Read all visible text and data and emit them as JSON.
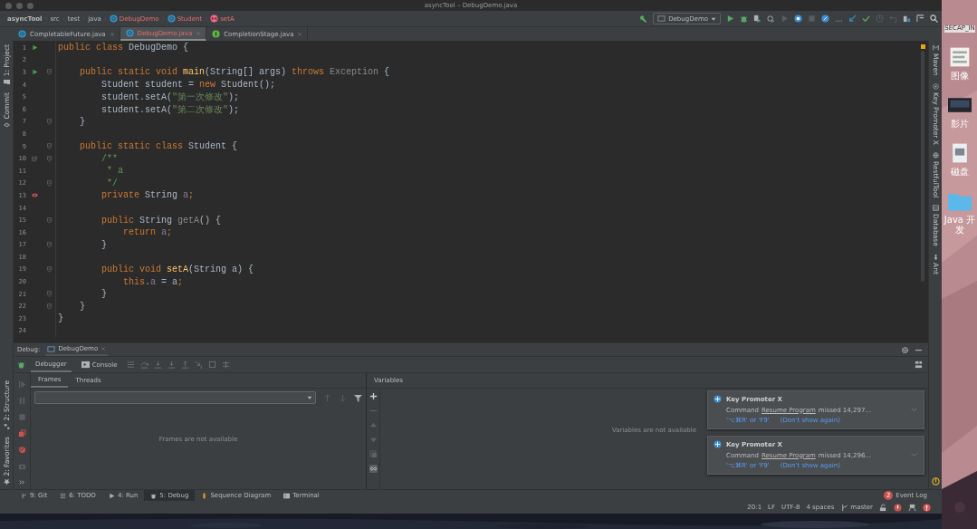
{
  "window": {
    "title": "asyncTool – DebugDemo.java"
  },
  "breadcrumbs": [
    {
      "label": "asyncTool",
      "kind": "project",
      "has_errors": false
    },
    {
      "label": "src",
      "kind": "folder",
      "has_errors": false
    },
    {
      "label": "test",
      "kind": "folder",
      "has_errors": false
    },
    {
      "label": "java",
      "kind": "folder",
      "has_errors": false
    },
    {
      "label": "DebugDemo",
      "kind": "class",
      "has_errors": true
    },
    {
      "label": "Student",
      "kind": "class",
      "has_errors": true
    },
    {
      "label": "setA",
      "kind": "method",
      "has_errors": true
    }
  ],
  "run_config": "DebugDemo",
  "editor_tabs": [
    {
      "label": "CompletableFuture.java",
      "kind": "class",
      "selected": false,
      "has_errors": false
    },
    {
      "label": "DebugDemo.java",
      "kind": "class",
      "selected": true,
      "has_errors": true
    },
    {
      "label": "CompletionStage.java",
      "kind": "interface",
      "selected": false,
      "has_errors": false
    }
  ],
  "left_tool_windows": [
    {
      "label": "1: Project",
      "kind": "folder"
    },
    {
      "label": "Commit",
      "kind": "commit"
    }
  ],
  "left_tool_windows_bottom": [
    {
      "label": "2: Structure",
      "kind": "structure"
    },
    {
      "label": "2: Favorites",
      "kind": "star"
    }
  ],
  "right_tool_windows": [
    {
      "label": "Maven",
      "kind": "m"
    },
    {
      "label": "Key Promoter X",
      "kind": "key"
    },
    {
      "label": "RestfulTool",
      "kind": "globe"
    },
    {
      "label": "Database",
      "kind": "db"
    },
    {
      "label": "Ant",
      "kind": "ant"
    }
  ],
  "code_lines": [
    {
      "number": "1",
      "runnable": true,
      "breakpoint": false,
      "doc_toggle": false,
      "fold": false,
      "tokens": [
        {
          "kind": "kw",
          "text": "public class "
        },
        {
          "kind": "plain",
          "text": "DebugDemo {"
        }
      ]
    },
    {
      "number": "2",
      "runnable": false,
      "breakpoint": false,
      "doc_toggle": false,
      "fold": false
    },
    {
      "number": "3",
      "runnable": true,
      "breakpoint": false,
      "doc_toggle": false,
      "fold": true,
      "tokens": [
        {
          "kind": "kw",
          "text": "    public static void "
        },
        {
          "kind": "decl",
          "text": "main"
        },
        {
          "kind": "plain",
          "text": "(String[] args) "
        },
        {
          "kind": "kw",
          "text": "throws "
        },
        {
          "kind": "gray",
          "text": "Exception "
        },
        {
          "kind": "plain",
          "text": "{"
        }
      ]
    },
    {
      "number": "4",
      "runnable": false,
      "breakpoint": false,
      "doc_toggle": false,
      "fold": false,
      "tokens": [
        {
          "kind": "plain",
          "text": "        Student student = "
        },
        {
          "kind": "kw",
          "text": "new "
        },
        {
          "kind": "plain",
          "text": "Student();"
        }
      ]
    },
    {
      "number": "5",
      "runnable": false,
      "breakpoint": false,
      "doc_toggle": false,
      "fold": false,
      "tokens": [
        {
          "kind": "plain",
          "text": "        student.setA("
        },
        {
          "kind": "str",
          "text": "\"第一次修改\""
        },
        {
          "kind": "plain",
          "text": ");"
        }
      ]
    },
    {
      "number": "6",
      "runnable": false,
      "breakpoint": false,
      "doc_toggle": false,
      "fold": false,
      "tokens": [
        {
          "kind": "plain",
          "text": "        student.setA("
        },
        {
          "kind": "str",
          "text": "\"第二次修改\""
        },
        {
          "kind": "plain",
          "text": ");"
        }
      ]
    },
    {
      "number": "7",
      "runnable": false,
      "breakpoint": false,
      "doc_toggle": false,
      "fold": true,
      "tokens": [
        {
          "kind": "plain",
          "text": "    }"
        }
      ]
    },
    {
      "number": "8",
      "runnable": false,
      "breakpoint": false,
      "doc_toggle": false,
      "fold": false
    },
    {
      "number": "9",
      "runnable": false,
      "breakpoint": false,
      "doc_toggle": false,
      "fold": true,
      "tokens": [
        {
          "kind": "kw",
          "text": "    public static class "
        },
        {
          "kind": "plain",
          "text": "Student {"
        }
      ]
    },
    {
      "number": "10",
      "runnable": false,
      "breakpoint": false,
      "doc_toggle": true,
      "fold": true,
      "tokens": [
        {
          "kind": "doc",
          "text": "        /**"
        }
      ]
    },
    {
      "number": "11",
      "runnable": false,
      "breakpoint": false,
      "doc_toggle": false,
      "fold": false,
      "tokens": [
        {
          "kind": "doc",
          "text": "         * a"
        }
      ]
    },
    {
      "number": "12",
      "runnable": false,
      "breakpoint": false,
      "doc_toggle": false,
      "fold": true,
      "tokens": [
        {
          "kind": "doc",
          "text": "         */"
        }
      ]
    },
    {
      "number": "13",
      "runnable": false,
      "breakpoint": true,
      "doc_toggle": false,
      "fold": false,
      "tokens": [
        {
          "kind": "kw",
          "text": "        private "
        },
        {
          "kind": "plain",
          "text": "String "
        },
        {
          "kind": "field",
          "text": "a"
        },
        {
          "kind": "kw",
          "text": ";"
        }
      ]
    },
    {
      "number": "14",
      "runnable": false,
      "breakpoint": false,
      "doc_toggle": false,
      "fold": false
    },
    {
      "number": "15",
      "runnable": false,
      "breakpoint": false,
      "doc_toggle": false,
      "fold": true,
      "tokens": [
        {
          "kind": "kw",
          "text": "        public "
        },
        {
          "kind": "plain",
          "text": "String "
        },
        {
          "kind": "gray",
          "text": "getA"
        },
        {
          "kind": "plain",
          "text": "() {"
        }
      ]
    },
    {
      "number": "16",
      "runnable": false,
      "breakpoint": false,
      "doc_toggle": false,
      "fold": false,
      "tokens": [
        {
          "kind": "kw",
          "text": "            return "
        },
        {
          "kind": "field",
          "text": "a"
        },
        {
          "kind": "kw",
          "text": ";"
        }
      ]
    },
    {
      "number": "17",
      "runnable": false,
      "breakpoint": false,
      "doc_toggle": false,
      "fold": true,
      "tokens": [
        {
          "kind": "plain",
          "text": "        }"
        }
      ]
    },
    {
      "number": "18",
      "runnable": false,
      "breakpoint": false,
      "doc_toggle": false,
      "fold": false
    },
    {
      "number": "19",
      "runnable": false,
      "breakpoint": false,
      "doc_toggle": false,
      "fold": true,
      "tokens": [
        {
          "kind": "kw",
          "text": "        public void "
        },
        {
          "kind": "decl",
          "text": "setA"
        },
        {
          "kind": "plain",
          "text": "(String a) {"
        }
      ]
    },
    {
      "number": "20",
      "runnable": false,
      "breakpoint": false,
      "doc_toggle": false,
      "fold": false,
      "tokens": [
        {
          "kind": "kw",
          "text": "            this"
        },
        {
          "kind": "plain",
          "text": "."
        },
        {
          "kind": "field",
          "text": "a"
        },
        {
          "kind": "plain",
          "text": " = a"
        },
        {
          "kind": "kw",
          "text": ";"
        }
      ]
    },
    {
      "number": "21",
      "runnable": false,
      "breakpoint": false,
      "doc_toggle": false,
      "fold": true,
      "tokens": [
        {
          "kind": "plain",
          "text": "        }"
        }
      ]
    },
    {
      "number": "22",
      "runnable": false,
      "breakpoint": false,
      "doc_toggle": false,
      "fold": true,
      "tokens": [
        {
          "kind": "plain",
          "text": "    }"
        }
      ]
    },
    {
      "number": "23",
      "runnable": false,
      "breakpoint": false,
      "doc_toggle": false,
      "fold": false,
      "tokens": [
        {
          "kind": "plain",
          "text": "}"
        }
      ]
    },
    {
      "number": "24",
      "runnable": false,
      "breakpoint": false,
      "doc_toggle": false,
      "fold": false
    }
  ],
  "debug": {
    "title": "Debug:",
    "session_tab": "DebugDemo",
    "tabs": [
      {
        "label": "Debugger",
        "kind": "debugger",
        "selected": true
      },
      {
        "label": "Console",
        "kind": "console",
        "selected": false
      }
    ],
    "frames_tabs": [
      {
        "label": "Frames",
        "selected": true
      },
      {
        "label": "Threads",
        "selected": false
      }
    ],
    "frames_empty": "Frames are not available",
    "variables_title": "Variables",
    "variables_empty": "Variables are not available"
  },
  "notifications": [
    {
      "title": "Key Promoter X",
      "message_before": "Command",
      "command": "Resume Program",
      "message_after": "missed 14,297…",
      "shortcut": "'⌥⌘R' or 'F9'",
      "dismiss": "(Don't show again)"
    },
    {
      "title": "Key Promoter X",
      "message_before": "Command",
      "command": "Resume Program",
      "message_after": "missed 14,296…",
      "shortcut": "'⌥⌘R' or 'F9'",
      "dismiss": "(Don't show again)"
    }
  ],
  "bottom_tabs": [
    {
      "label": "9: Git",
      "kind": "git",
      "selected": false
    },
    {
      "label": "6: TODO",
      "kind": "todo",
      "selected": false
    },
    {
      "label": "4: Run",
      "kind": "run",
      "selected": false
    },
    {
      "label": "5: Debug",
      "kind": "debug",
      "selected": true
    },
    {
      "label": "Sequence Diagram",
      "kind": "sequence",
      "selected": false
    },
    {
      "label": "Terminal",
      "kind": "terminal",
      "selected": false
    }
  ],
  "event_log": {
    "label": "Event Log",
    "count": "2"
  },
  "status_bar": {
    "position": "20:1",
    "line_separator": "LF",
    "encoding": "UTF-8",
    "indent": "4 spaces",
    "branch": "master"
  },
  "desktop_icons": [
    {
      "label": "SECAP_IN",
      "kind": "none"
    },
    {
      "label": "图像",
      "kind": "document"
    },
    {
      "label": "影片",
      "kind": "screen"
    },
    {
      "label": "磁盘",
      "kind": "disk"
    },
    {
      "label": "Java 开发",
      "kind": "folder"
    }
  ]
}
